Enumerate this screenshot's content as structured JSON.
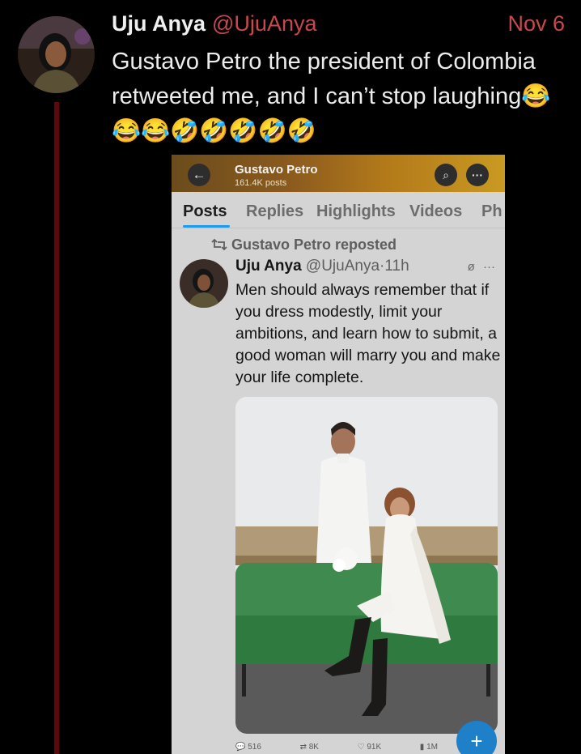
{
  "tweet": {
    "author_name": "Uju Anya",
    "author_handle": "@UjuAnya",
    "date": "Nov 6",
    "text": "Gustavo Petro the president of Colombia retweeted me, and I can’t stop laughing😂😂😂🤣🤣🤣🤣🤣"
  },
  "screenshot": {
    "header": {
      "back_icon": "←",
      "profile_name": "Gustavo Petro",
      "post_count": "161.4K posts",
      "search_icon": "⌕",
      "more_icon": "···"
    },
    "tabs": [
      "Posts",
      "Replies",
      "Highlights",
      "Videos",
      "Ph"
    ],
    "repost_label": "Gustavo Petro reposted",
    "inner_post": {
      "author_name": "Uju Anya",
      "author_handle": "@UjuAnya",
      "time": "·11h",
      "text": "Men should always remember that if you dress modestly, limit your ambitions, and learn how to submit, a good woman will marry you and make your life complete."
    },
    "stats": {
      "replies": "516",
      "reposts": "8K",
      "likes": "91K",
      "views": "1M"
    },
    "fab_icon": "+"
  },
  "colors": {
    "background": "#000000",
    "handle_red": "#c8484b",
    "thread_line": "#5e0a0a",
    "accent_blue": "#1d9bf0"
  }
}
